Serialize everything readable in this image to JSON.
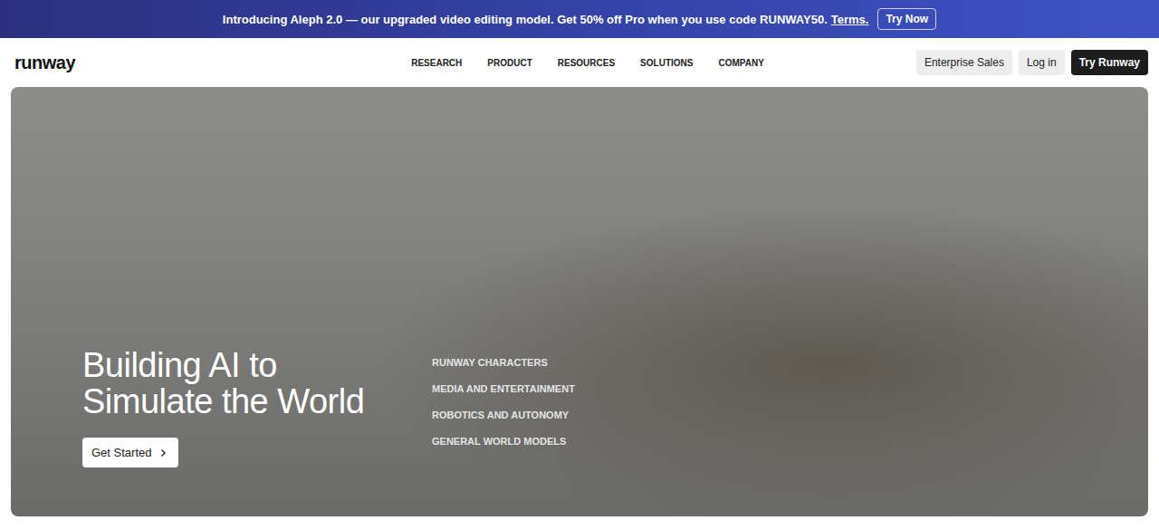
{
  "banner": {
    "text": "Introducing Aleph 2.0 — our upgraded video editing model. Get 50% off Pro when you use code RUNWAY50.",
    "link": "Terms.",
    "button": "Try Now"
  },
  "logo": "runway",
  "nav": {
    "items": [
      "RESEARCH",
      "PRODUCT",
      "RESOURCES",
      "SOLUTIONS",
      "COMPANY"
    ],
    "actions": [
      {
        "label": "Enterprise Sales",
        "kind": "secondary"
      },
      {
        "label": "Log in",
        "kind": "secondary"
      },
      {
        "label": "Try Runway",
        "kind": "primary"
      }
    ]
  },
  "hero": {
    "title_lines": [
      "Building AI to",
      "Simulate the World"
    ],
    "button": "Get Started",
    "links": [
      "RUNWAY CHARACTERS",
      "MEDIA AND ENTERTAINMENT",
      "ROBOTICS AND AUTONOMY",
      "GENERAL WORLD MODELS"
    ]
  }
}
